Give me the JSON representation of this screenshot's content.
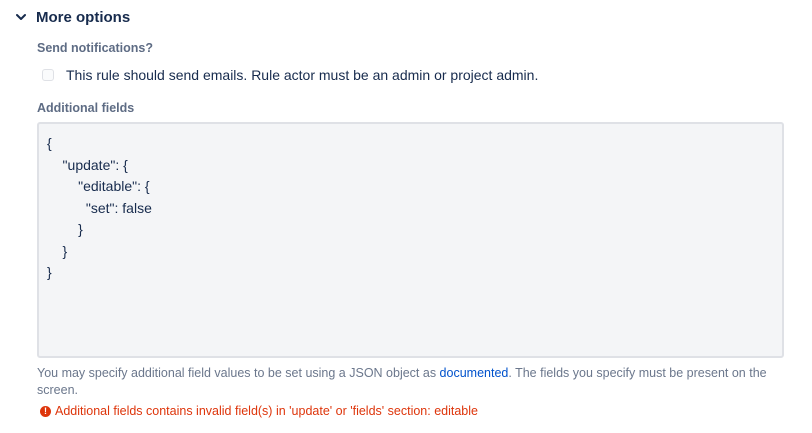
{
  "section": {
    "title": "More options",
    "chevron_icon": "chevron-down-icon"
  },
  "notifications": {
    "label": "Send notifications?",
    "checkbox_label": "This rule should send emails. Rule actor must be an admin or project admin.",
    "checked": false
  },
  "additional_fields": {
    "label": "Additional fields",
    "value": "{\n    \"update\": {\n        \"editable\": {\n          \"set\": false\n        }\n    }\n}"
  },
  "help": {
    "prefix": "You may specify additional field values to be set using a JSON object as ",
    "link_text": "documented",
    "suffix": ". The fields you specify must be present on the screen."
  },
  "error": {
    "icon": "error-icon",
    "icon_glyph": "!",
    "message": "Additional fields contains invalid field(s) in 'update' or 'fields' section: editable"
  },
  "colors": {
    "error": "#de350b",
    "link": "#0052cc",
    "text": "#172b4d",
    "muted": "#6b778c"
  }
}
